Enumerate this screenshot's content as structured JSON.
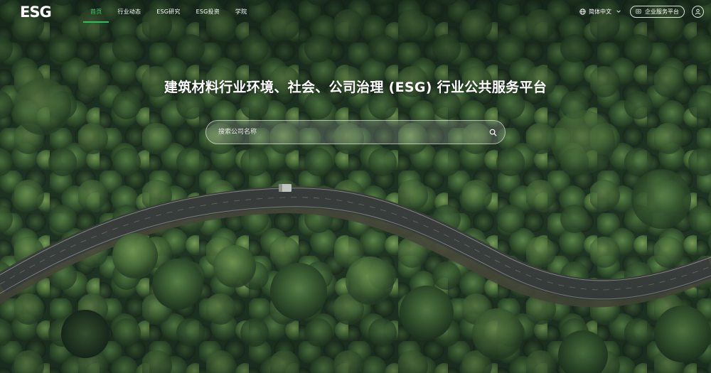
{
  "brand": {
    "logo_text": "ESG"
  },
  "nav": {
    "items": [
      {
        "label": "首页",
        "active": true
      },
      {
        "label": "行业动态",
        "active": false
      },
      {
        "label": "ESG研究",
        "active": false
      },
      {
        "label": "ESG投资",
        "active": false
      },
      {
        "label": "学院",
        "active": false
      }
    ]
  },
  "tools": {
    "language": "简体中文",
    "service_button": "企业服务平台"
  },
  "hero": {
    "title": "建筑材料行业环境、社会、公司治理 (ESG) 行业公共服务平台"
  },
  "search": {
    "placeholder": "搜索公司名称",
    "value": ""
  },
  "colors": {
    "accent": "#2fbf5c",
    "active_text": "#3fcf6d",
    "forest_dark": "#1d2a1f",
    "forest_mid": "#3a5a32",
    "road": "#3a3f3e"
  },
  "icons": [
    "globe-icon",
    "chevron-down-icon",
    "service-icon",
    "user-icon",
    "search-icon"
  ]
}
